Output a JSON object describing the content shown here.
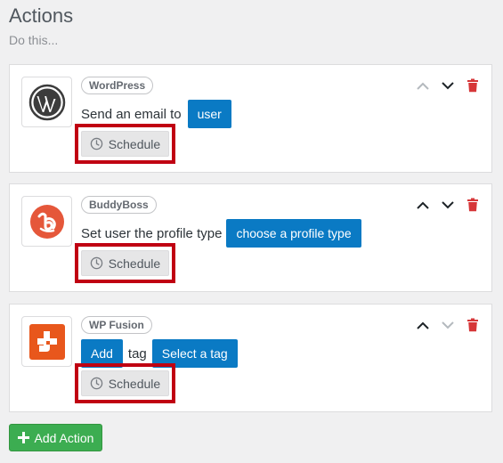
{
  "header": {
    "title": "Actions",
    "subtitle": "Do this..."
  },
  "actions": [
    {
      "integration": "WordPress",
      "icon": "wordpress-logo-icon",
      "text_before": "Send an email to",
      "token_1": "user",
      "schedule_label": "Schedule",
      "move_up_enabled": false,
      "move_down_enabled": true
    },
    {
      "integration": "BuddyBoss",
      "icon": "buddyboss-logo-icon",
      "text_before": "Set user the profile type",
      "token_1": "choose a profile type",
      "schedule_label": "Schedule",
      "move_up_enabled": true,
      "move_down_enabled": true
    },
    {
      "integration": "WP Fusion",
      "icon": "wp-fusion-logo-icon",
      "token_1": "Add",
      "text_middle": "tag",
      "token_2": "Select a tag",
      "schedule_label": "Schedule",
      "move_up_enabled": true,
      "move_down_enabled": false
    }
  ],
  "add_action_label": "Add Action",
  "colors": {
    "accent_blue": "#0a7ac4",
    "delete_red": "#d63638",
    "highlight_red": "#c00012",
    "add_green": "#3cad51",
    "buddyboss_orange": "#e5573a",
    "wpfusion_orange": "#e8571c"
  }
}
